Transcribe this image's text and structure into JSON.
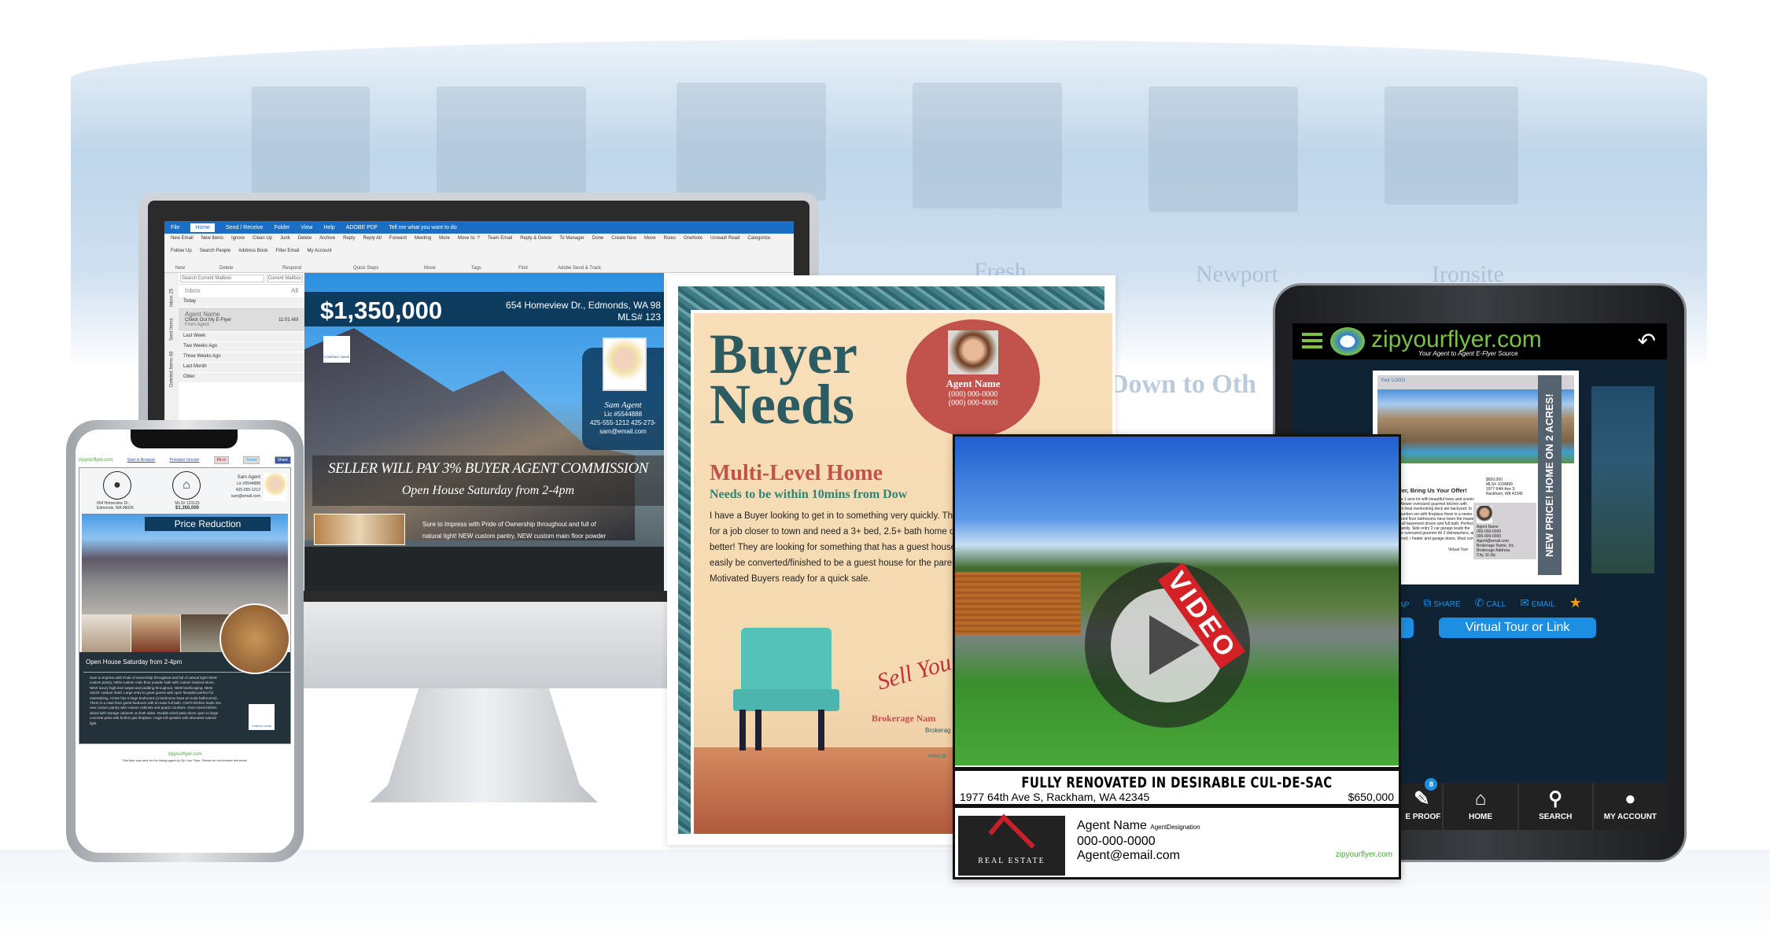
{
  "background_words": [
    "Fresh",
    "Newport",
    "Ironsite",
    "Down to Oth"
  ],
  "outlook": {
    "tabs": [
      "File",
      "Home",
      "Send / Receive",
      "Folder",
      "View",
      "Help",
      "ADOBE PDF"
    ],
    "tell_me": "Tell me what you want to do",
    "ribbon": [
      "New Email",
      "New Items",
      "Ignore",
      "Clean Up",
      "Junk",
      "Delete",
      "Archive",
      "Reply",
      "Reply All",
      "Forward",
      "Meeting",
      "More",
      "Move to: ?",
      "Team Email",
      "Reply & Delete",
      "To Manager",
      "Done",
      "Create New",
      "Move",
      "Rules",
      "OneNote",
      "Unread/ Read",
      "Categorize",
      "Follow Up",
      "Search People",
      "Address Book",
      "Filter Email",
      "My Account"
    ],
    "ribbon_groups": [
      "New",
      "Delete",
      "Respond",
      "Quick Steps",
      "Move",
      "Tags",
      "Find",
      "Adobe Send & Track"
    ],
    "nav": [
      "Inbox 25",
      "Sent Items",
      "Deleted Items 48"
    ],
    "search_placeholder": "Search Current Mailbox",
    "scope": "Current Mailbox",
    "folder": "Inbox",
    "filter": "All",
    "groups": [
      "Today",
      "Last Week",
      "Two Weeks Ago",
      "Three Weeks Ago",
      "Last Month",
      "Older"
    ],
    "message": {
      "sender": "Agent Name",
      "subject": "Check Out My E-Flyer",
      "time": "11:01 AM",
      "preview": "From Agent"
    }
  },
  "email_flyer": {
    "price": "$1,350,000",
    "address": "654 Homeview Dr., Edmonds, WA 98",
    "mls": "MLS# 123",
    "company": "COMPANY NAME",
    "agent_name": "Sam Agent",
    "license": "Lic #5544888",
    "phones": "425-555-1212  425-273-",
    "email": "sam@email.com",
    "headline": "SELLER WILL PAY 3% BUYER AGENT COMMISSION",
    "open_house": "Open House Saturday from 2-4pm",
    "body": [
      "Sure to Impress with Pride of Ownership throughout and full of",
      "natural light! NEW custom pantry, NEW custom main floor powder"
    ]
  },
  "phone_flyer": {
    "brand": "zipyourflyer.com",
    "links": [
      "Start in Browser",
      "Printable Version"
    ],
    "share_buttons": [
      "Pin it",
      "Tweet",
      "Share"
    ],
    "address": "654 Homeview Dr., Edmonds, WA 98026",
    "mls": "MLS# 123123",
    "price": "$1,350,000",
    "agent": [
      "Sam Agent",
      "Lic #5544888",
      "425-555-1212",
      "sam@email.com"
    ],
    "banner": "Price Reduction",
    "open_house": "Open House Saturday from 2-4pm",
    "description": "Sure to Impress with Pride of Ownership throughout and full of natural light! NEW custom pantry, NEW custom main floor powder bath with custom stacked stone, NEW luxury high-end carpet and padding throughout, NEW landscaping, NEW 10x20' outdoor shed. Large entry to greet guests with open floorplan perfect for entertaining. Home has 5 large bedrooms (3 bedrooms have en-suite bathrooms). There is a main floor guest bedroom with en-suite full bath. Chef's kitchen leads into new custom pantry with custom cabinets and quartz counters. Over-sized kitchen island with storage cabinets on both sides. Double-sized patio doors open to large concrete patio with built-in gas fireplace. Huge loft upstairs with abundant natural light.",
    "company": "COMPANY NAME",
    "footer": "This flyer was sent for the listing agent by Zip Your Flyer. Please do not forward this email."
  },
  "buyer_flyer": {
    "title_line1": "Buyer",
    "title_line2": "Needs",
    "agent_name": "Agent Name",
    "agent_phone1": "(000) 000-0000",
    "agent_phone2": "(000) 000-0000",
    "subtitle": "Multi-Level Home",
    "subtitle2": "Needs to be within 10mins from Dow",
    "body": "I have a Buyer looking to get in to something very quickly. They for a job closer to town and need a 3+ bed, 2.5+ bath home or better! They are looking for something that has a guest house/c easily be converted/finished to be a guest house for the parents Motivated Buyers ready for a quick sale.",
    "script": "Sell You",
    "brokerage": "Brokerage Nam",
    "brokerage2": "Brokerag",
    "website": "www.Br"
  },
  "video_flyer": {
    "badge": "VIDEO",
    "headline": "FULLY RENOVATED IN DESIRABLE CUL-DE-SAC",
    "address": "1977 64th Ave S, Rackham, WA 42345",
    "price": "$650,000",
    "logo_text": "REAL ESTATE",
    "agent_name": "Agent Name",
    "agent_designation": "AgentDesignation",
    "phone": "000-000-0000",
    "email": "Agent@email.com",
    "brand": "zipyourflyer.com"
  },
  "tablet": {
    "brand": "zipyourflyer.com",
    "tagline": "Your Agent to Agent E-Flyer Source",
    "flyer": {
      "logo": "Your LOGO",
      "side_banner": "NEW PRICE! HOME ON 2 ACRES!",
      "offer": "ated Seller, Bring Us Your Offer!",
      "body": "home sits on a 1 acre lot with beautiful trees and scenic landscaping. Newer oversized gourmet kitchen with ashers, radiant heat overlooking deck ate backyard. In addition to a sunken om with fireplace there is a newer den/ both second floor bathrooms have been the master has radiant. Full basement droom and full bath. Perfect for a live-in ded family. Side entry 2 car garage leads the kitchen. Newer oversized gourmet ith 2 dishwashers, air conditioning, roof, r heater and garage doors. Must come a look.",
      "virtual_tour": "Virtual Tour",
      "price": "$650,000",
      "mls": "MLS# 1034899",
      "address": "1977 64th Ave S Rackham, WA 42345",
      "agent": [
        "Agent Name",
        "000-000-0000",
        "000-000-0000",
        "Agent@email.com",
        "Brokerage Name, Inc.",
        "Brokerage Address",
        "City, St Zip"
      ]
    },
    "actions": [
      "MAP",
      "SHARE",
      "CALL",
      "EMAIL"
    ],
    "buttons": [
      "or Link",
      "Virtual Tour or Link"
    ],
    "nav": [
      {
        "label": "E PROOF",
        "badge": "8"
      },
      {
        "label": "HOME"
      },
      {
        "label": "SEARCH"
      },
      {
        "label": "MY ACCOUNT"
      }
    ]
  },
  "colors": {
    "brand_green": "#7bc144",
    "brand_blue": "#1e8fe0",
    "flyer_navy": "#0d3b5e",
    "buyer_teal": "#2c5c61",
    "buyer_red": "#c1524c",
    "video_red": "#d42126"
  }
}
